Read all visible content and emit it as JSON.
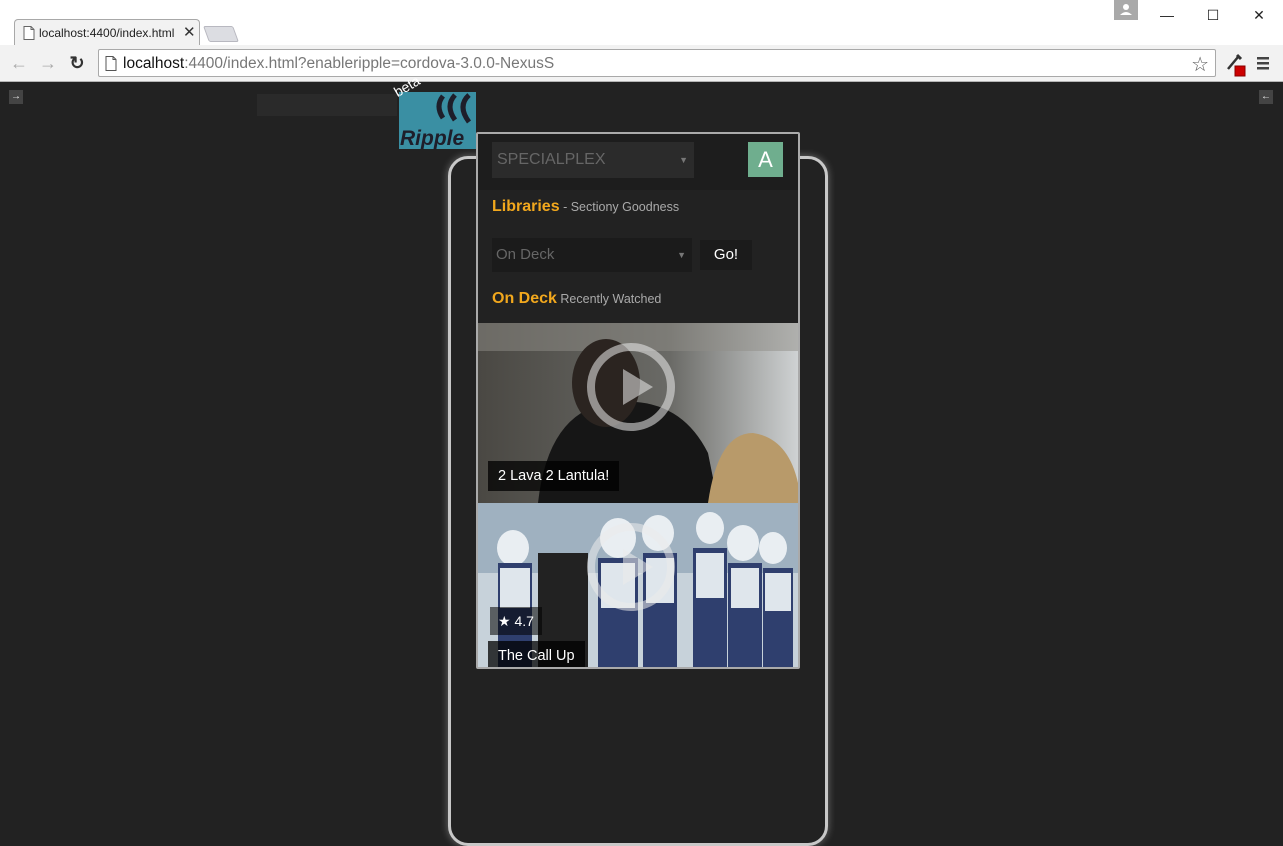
{
  "browser": {
    "tab_title": "localhost:4400/index.html",
    "tab_close": "✕",
    "url_host": "localhost",
    "url_rest": ":4400/index.html?enableripple=cordova-3.0.0-NexusS",
    "icons": [
      "page-icon",
      "back-icon",
      "forward-icon",
      "reload-icon",
      "bookmark-star-icon",
      "eyedropper-extension-icon",
      "menu-icon",
      "profile-icon"
    ],
    "window_controls": {
      "minimize": "—",
      "maximize": "☐",
      "close": "✕"
    },
    "nav": {
      "back": "←",
      "forward": "→",
      "reload": "↻"
    },
    "star": "☆"
  },
  "ripple": {
    "beta_label": "beta",
    "logo_text": "Ripple",
    "left_toggle": "→",
    "right_toggle": "←",
    "brand_color": "#3a8fa3"
  },
  "app": {
    "server_select": "SPECIALPLEX",
    "avatar_letter": "A",
    "avatar_color": "#6fae8e",
    "accent_color": "#f2a81d",
    "libraries": {
      "title": "Libraries",
      "subtitle": " - Sectiony Goodness"
    },
    "library_select": "On Deck",
    "go_button": "Go!",
    "on_deck": {
      "title": "On Deck",
      "subtitle": " Recently Watched"
    },
    "cards": [
      {
        "title": "2 Lava 2 Lantula!"
      },
      {
        "title": "The Call Up",
        "rating": "4.7"
      }
    ]
  }
}
